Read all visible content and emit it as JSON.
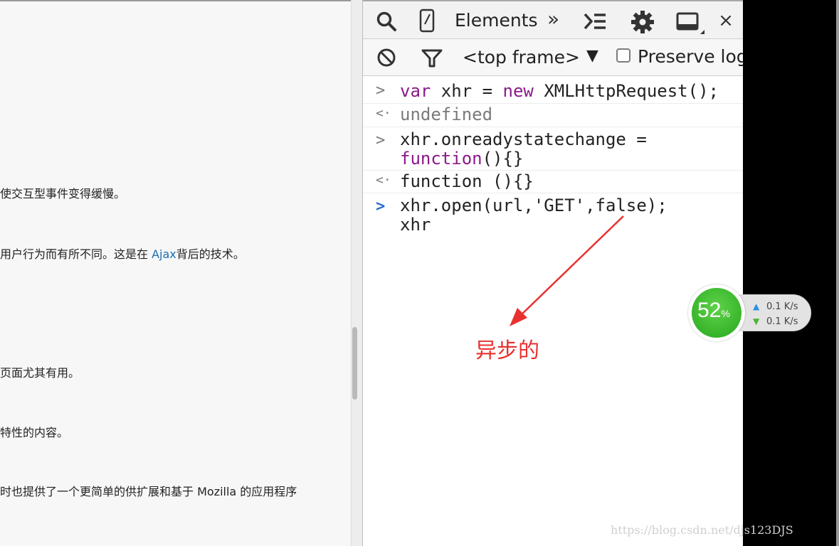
{
  "left_page": {
    "lines": [
      {
        "text": "使交互型事件变得缓慢。"
      },
      {
        "pre": "用户行为而有所不同。这是在 ",
        "link": "Ajax",
        "post": "背后的技术。"
      },
      {
        "text": "页面尤其有用。"
      },
      {
        "text": "特性的内容。"
      },
      {
        "text": "时也提供了一个更简单的供扩展和基于 Mozilla 的应用程序"
      }
    ]
  },
  "devtools": {
    "tab_elements": "Elements",
    "more_tabs": "»",
    "close_label": "×",
    "frame_select": "<top frame>",
    "frame_arrow": "▼",
    "preserve_log_label": "Preserve log",
    "icons": {
      "search": "search-icon",
      "device": "device-mode-icon",
      "console_drawer": "console-drawer-icon",
      "settings": "gear-icon",
      "dock": "dock-side-icon",
      "clear": "clear-console-icon",
      "filter": "filter-icon"
    },
    "console": {
      "rows": [
        {
          "prompt": ">",
          "kw": "var",
          "mid": " xhr = ",
          "kw2": "new",
          "rest": " XMLHttpRequest();"
        },
        {
          "prompt": "<·",
          "result": "undefined"
        },
        {
          "prompt": ">",
          "line1": "xhr.onreadystatechange =",
          "kw": "function",
          "line2rest": "(){}"
        },
        {
          "prompt": "<·",
          "result": "function (){}"
        },
        {
          "prompt": ">",
          "line1": "xhr.open(url,'GET',false);",
          "line2": "xhr"
        }
      ]
    }
  },
  "annotation": {
    "text": "异步的",
    "color": "#e8312f"
  },
  "network_widget": {
    "percent": "52",
    "percent_sign": "%",
    "upload": "0.1 K/s",
    "download": "0.1 K/s"
  },
  "watermark": "https://blog.csdn.net/djs123DJS"
}
